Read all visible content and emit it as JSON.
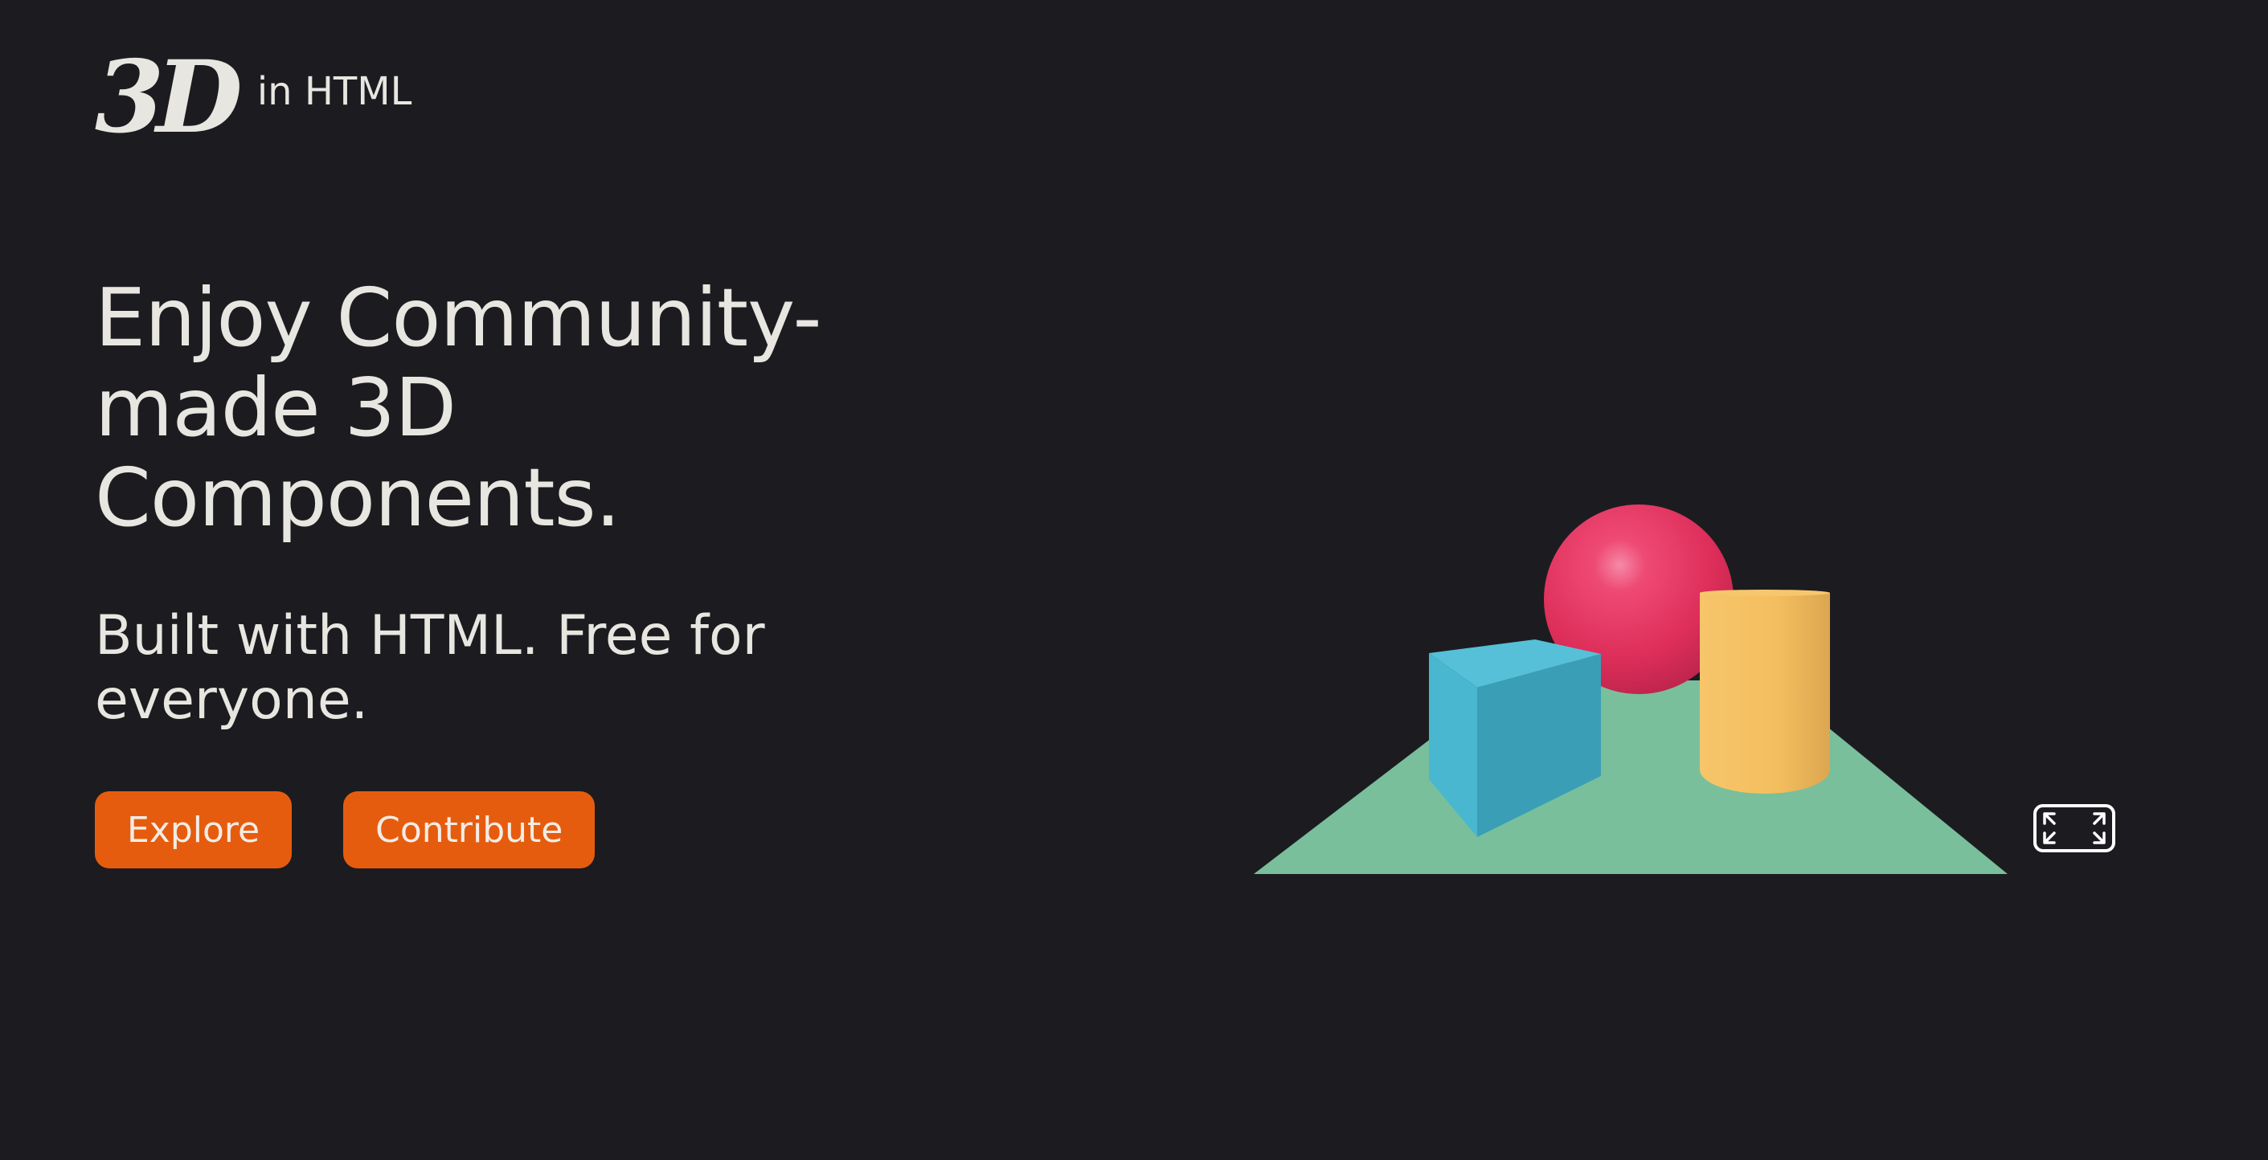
{
  "header": {
    "logo_mark": "3D",
    "logo_suffix": "in HTML"
  },
  "hero": {
    "headline": "Enjoy Community-made 3D Components.",
    "subhead": "Built with HTML. Free for everyone."
  },
  "actions": {
    "explore_label": "Explore",
    "contribute_label": "Contribute"
  },
  "scene": {
    "objects": [
      "plane",
      "sphere",
      "cube",
      "cylinder"
    ],
    "colors": {
      "plane": "#79bf9b",
      "sphere": "#e8305f",
      "cube_front": "#4ab7d0",
      "cube_side": "#3a9fb6",
      "cylinder": "#f3bd5c",
      "background": "#1c1c20",
      "button": "#e65c0e"
    },
    "fullscreen_icon": "expand-icon"
  }
}
